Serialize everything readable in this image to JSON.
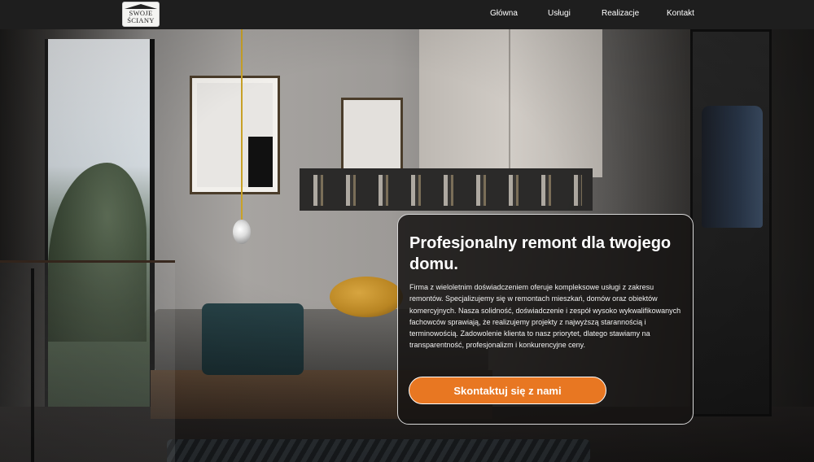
{
  "header": {
    "logo": {
      "line1": "SWOJE",
      "line2": "ŚCIANY"
    },
    "nav": [
      {
        "label": "Główna"
      },
      {
        "label": "Usługi"
      },
      {
        "label": "Realizacje"
      },
      {
        "label": "Kontakt"
      }
    ]
  },
  "hero": {
    "title": "Profesjonalny remont dla twojego domu.",
    "description": "Firma z wieloletnim doświadczeniem oferuje kompleksowe usługi z zakresu remontów. Specjalizujemy się w remontach mieszkań, domów oraz obiektów komercyjnych. Nasza solidność, doświadczenie i zespół wysoko wykwalifikowanych fachowców sprawiają, że realizujemy projekty z najwyższą starannością i terminowością. Zadowolenie klienta to nasz priorytet, dlatego stawiamy na transparentność, profesjonalizm i konkurencyjne ceny.",
    "cta_label": "Skontaktuj się z nami"
  },
  "colors": {
    "accent": "#e87722",
    "header_bg": "#1e1e1e",
    "card_bg": "#161413"
  }
}
